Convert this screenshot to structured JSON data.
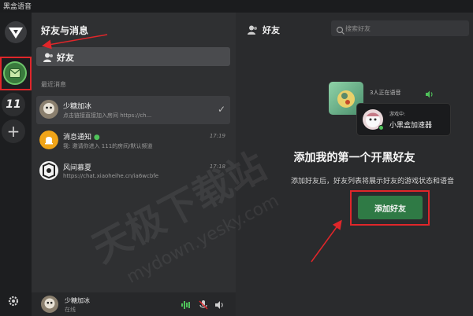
{
  "app": {
    "title": "黑盒语音"
  },
  "rail": {
    "server_label": "11"
  },
  "panel": {
    "title": "好友与消息",
    "friends_label": "好友",
    "recent_label": "最近消息",
    "messages": [
      {
        "name": "少糖加冰",
        "preview": "点击链接直接加入房间 https://ch...",
        "time": "",
        "active": true
      },
      {
        "name": "消息通知",
        "preview": "我: 邀请你进入 111的房间/默认频道",
        "time": "17:19",
        "active": false
      },
      {
        "name": "风间慕夏",
        "preview": "https://chat.xiaoheihe.cn/ia6wcbfe",
        "time": "17:18",
        "active": false
      }
    ]
  },
  "user": {
    "name": "少糖加冰",
    "status": "在线"
  },
  "main": {
    "title": "好友",
    "search_placeholder": "搜索好友",
    "illustration": {
      "voice_text": "3人正在语音",
      "playing_label": "游戏中:",
      "game_name": "小黑盒加速器"
    },
    "headline": "添加我的第一个开黑好友",
    "subtext": "添加好友后，好友列表将展示好友的游戏状态和语音",
    "add_button": "添加好友"
  },
  "watermark": {
    "text": "天极下载站",
    "url": "mydown.yesky.com"
  },
  "colors": {
    "accent_green": "#2f7a45",
    "annotation_red": "#e0262a",
    "online": "#4fc25a"
  }
}
